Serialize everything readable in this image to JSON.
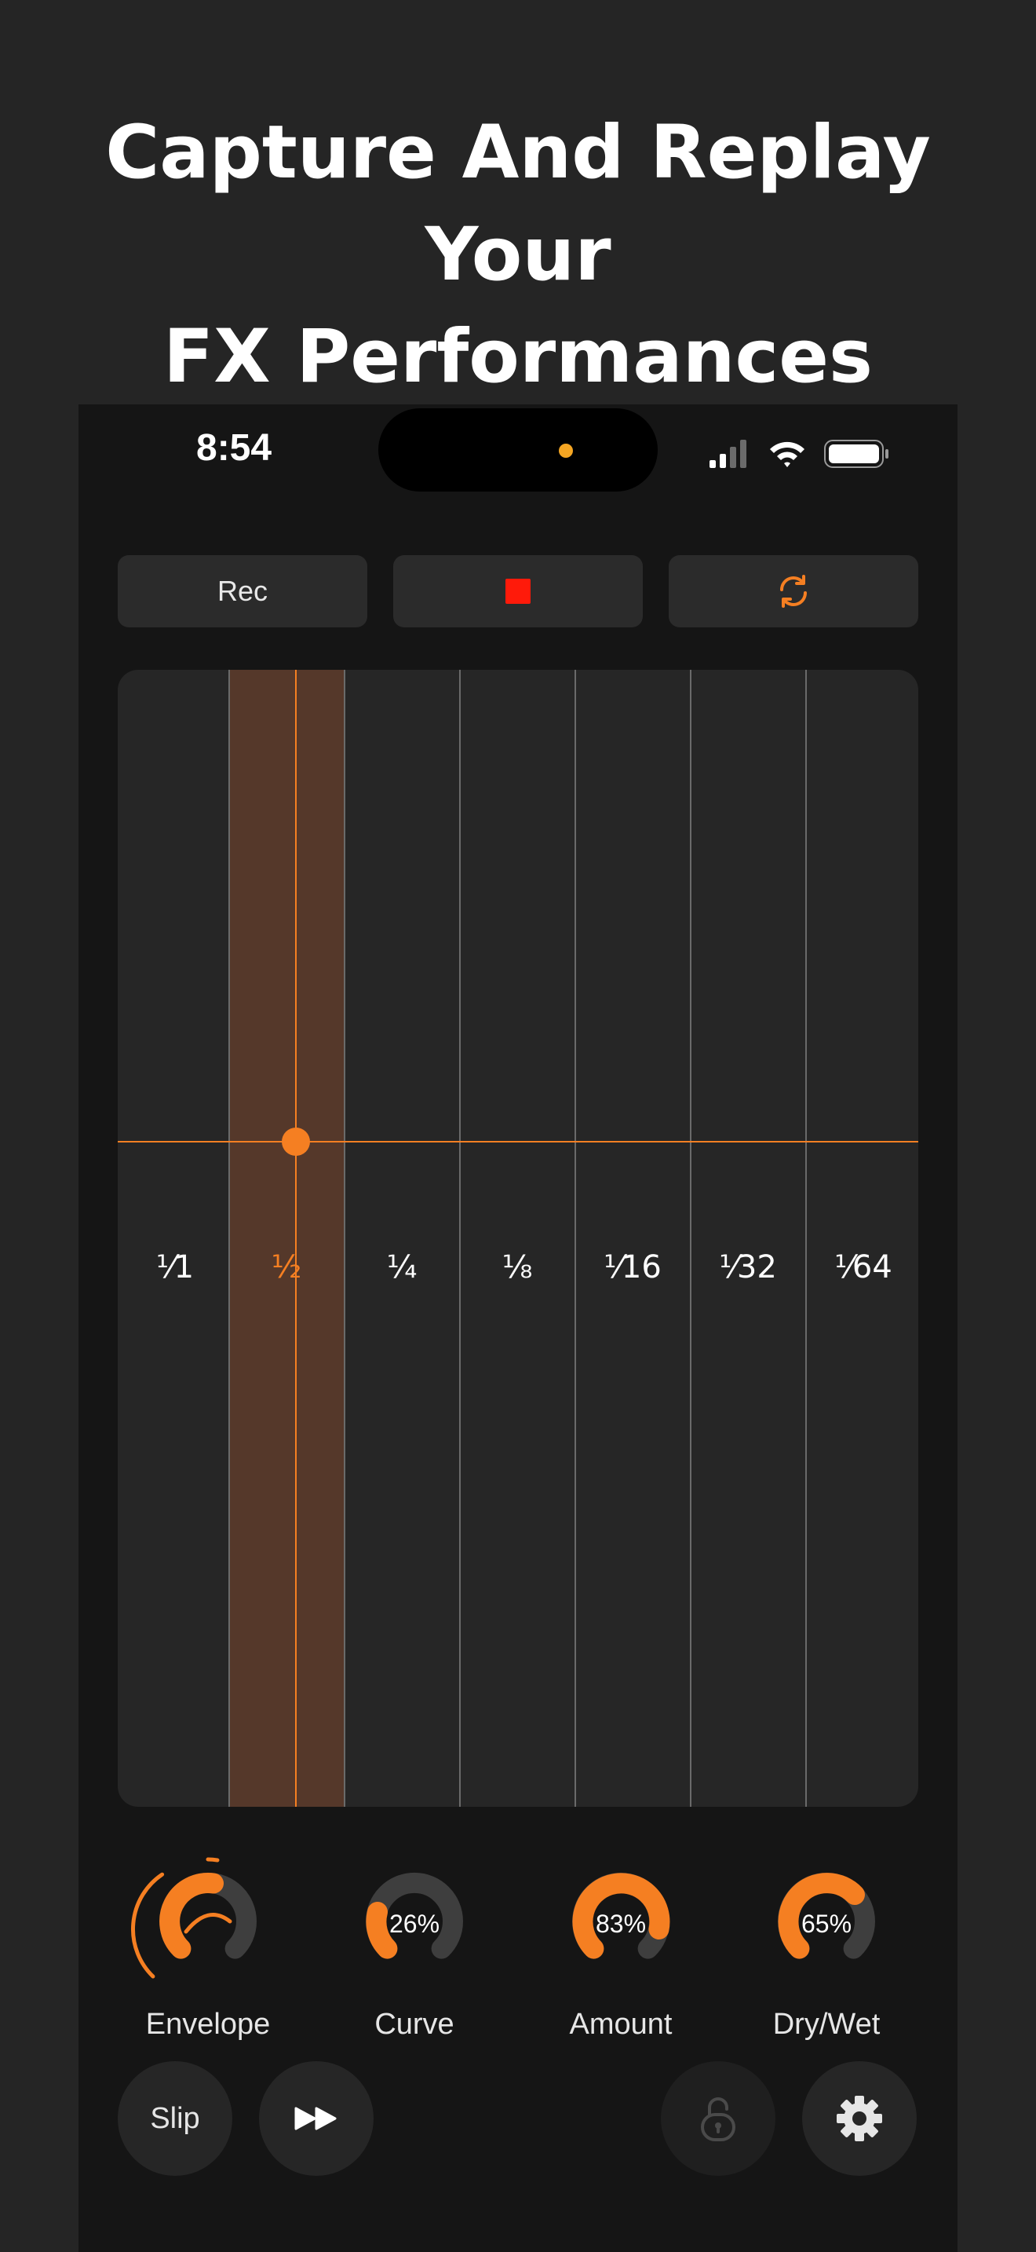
{
  "headline": {
    "line1": "Capture And Replay Your",
    "line2": "FX Performances"
  },
  "status_bar": {
    "time": "8:54"
  },
  "transport": {
    "rec_label": "Rec",
    "stop_icon": "stop-square-icon",
    "loop_icon": "loop-refresh-icon"
  },
  "grid": {
    "columns": [
      {
        "label": "⅟1"
      },
      {
        "label": "½"
      },
      {
        "label": "¼"
      },
      {
        "label": "⅛"
      },
      {
        "label": "⅟16"
      },
      {
        "label": "⅟32"
      },
      {
        "label": "⅟64"
      }
    ],
    "active_column": 1
  },
  "knobs": [
    {
      "label": "Envelope",
      "value": "",
      "fraction": 0.55
    },
    {
      "label": "Curve",
      "value": "26%",
      "fraction": 0.26
    },
    {
      "label": "Amount",
      "value": "83%",
      "fraction": 0.83
    },
    {
      "label": "Dry/Wet",
      "value": "65%",
      "fraction": 0.65
    }
  ],
  "bottom_controls": {
    "slip_label": "Slip",
    "fast_forward_icon": "fast-forward-icon",
    "lock_icon": "unlock-icon",
    "settings_icon": "gear-icon"
  },
  "colors": {
    "accent": "#f57f22",
    "stop": "#ff1a0a",
    "panel": "#262626",
    "highlight": "#55382a"
  }
}
